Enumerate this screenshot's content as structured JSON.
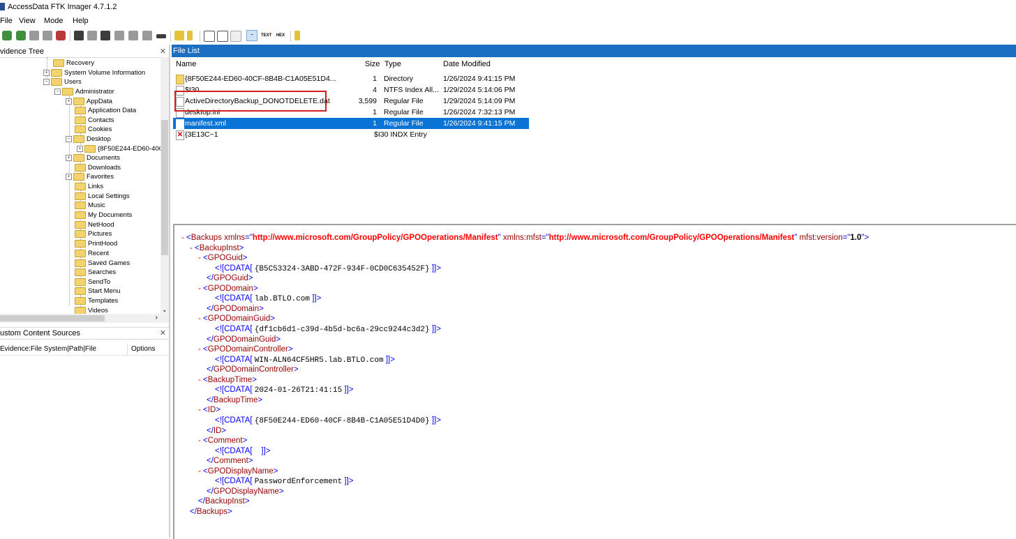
{
  "title": "AccessData FTK Imager 4.7.1.2",
  "menu": [
    "File",
    "View",
    "Mode",
    "Help"
  ],
  "panels": {
    "evidence_tree": "vidence Tree",
    "custom_content": "ustom Content Sources",
    "custom_columns": [
      "Evidence:File System|Path|File",
      "Options"
    ],
    "file_list": "File List"
  },
  "tree": [
    "Recovery",
    "System Volume Information",
    "Users",
    "Administrator",
    "AppData",
    "Application Data",
    "Contacts",
    "Cookies",
    "Desktop",
    "{8F50E244-ED60-40C",
    "Documents",
    "Downloads",
    "Favorites",
    "Links",
    "Local Settings",
    "Music",
    "My Documents",
    "NetHood",
    "Pictures",
    "PrintHood",
    "Recent",
    "Saved Games",
    "Searches",
    "SendTo",
    "Start Menu",
    "Templates",
    "Videos"
  ],
  "columns": {
    "name": "Name",
    "size": "Size",
    "type": "Type",
    "date": "Date Modified"
  },
  "files": [
    {
      "name": "{8F50E244-ED60-40CF-8B4B-C1A05E51D4...",
      "size": "1",
      "type": "Directory",
      "date": "1/26/2024 9:41:15 PM"
    },
    {
      "name": "$I30",
      "size": "4",
      "type": "NTFS Index All...",
      "date": "1/29/2024 5:14:06 PM"
    },
    {
      "name": "ActiveDirectoryBackup_DONOTDELETE.dat",
      "size": "3,599",
      "type": "Regular File",
      "date": "1/29/2024 5:14:09 PM"
    },
    {
      "name": "desktop.ini",
      "size": "1",
      "type": "Regular File",
      "date": "1/26/2024 7:32:13 PM"
    },
    {
      "name": "manifest.xml",
      "size": "1",
      "type": "Regular File",
      "date": "1/26/2024 9:41:15 PM"
    },
    {
      "name": "{3E13C~1",
      "size": "",
      "type": "$I30 INDX Entry",
      "date": ""
    }
  ],
  "xml": {
    "root_attr_ns": "xmlns",
    "ns_url": "http://www.microsoft.com/GroupPolicy/GPOOperations/Manifest",
    "mfst_attr": "xmlns:mfst",
    "ver_attr": "mfst:version",
    "ver_val": "1.0",
    "gpo_guid": "{B5C53324-3ABD-472F-934F-0CD0C635452F}",
    "gpo_domain": "lab.BTLO.com",
    "gpo_domain_guid": "{df1cb6d1-c39d-4b5d-bc6a-29cc9244c3d2}",
    "gpo_domain_controller": "WIN-ALN64CF5HR5.lab.BTLO.com",
    "backup_time": "2024-01-26T21:41:15",
    "id": "{8F50E244-ED60-40CF-8B4B-C1A05E51D4D0}",
    "comment": "",
    "gpo_display_name": "PasswordEnforcement"
  }
}
